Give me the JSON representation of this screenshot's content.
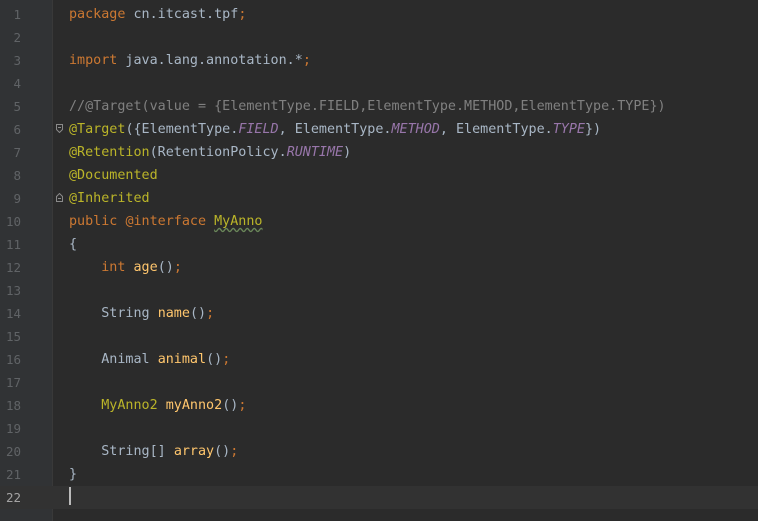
{
  "editor": {
    "current_line": 22,
    "lines": [
      {
        "number": "1",
        "t1": "package",
        "t2": " cn.itcast.tpf",
        "t3": ";"
      },
      {
        "number": "2"
      },
      {
        "number": "3",
        "t1": "import",
        "t2": " java.lang.annotation.*",
        "t3": ";"
      },
      {
        "number": "4"
      },
      {
        "number": "5",
        "t1": "//@Target(value = {ElementType.FIELD,ElementType.METHOD,ElementType.TYPE})"
      },
      {
        "number": "6",
        "t1": "@Target",
        "t2": "({ElementType.",
        "t3": "FIELD",
        "t4": ", ElementType.",
        "t5": "METHOD",
        "t6": ", ElementType.",
        "t7": "TYPE",
        "t8": "})"
      },
      {
        "number": "7",
        "t1": "@Retention",
        "t2": "(RetentionPolicy.",
        "t3": "RUNTIME",
        "t4": ")"
      },
      {
        "number": "8",
        "t1": "@Documented"
      },
      {
        "number": "9",
        "t1": "@Inherited"
      },
      {
        "number": "10",
        "t1": "public",
        "t2": " ",
        "t3": "@interface",
        "t4": " ",
        "t5": "MyAnno"
      },
      {
        "number": "11",
        "t1": "{"
      },
      {
        "number": "12",
        "t1": "    ",
        "t2": "int",
        "t3": " ",
        "t4": "age",
        "t5": "()",
        "t6": ";"
      },
      {
        "number": "13"
      },
      {
        "number": "14",
        "t1": "    String ",
        "t2": "name",
        "t3": "()",
        "t4": ";"
      },
      {
        "number": "15"
      },
      {
        "number": "16",
        "t1": "    Animal ",
        "t2": "animal",
        "t3": "()",
        "t4": ";"
      },
      {
        "number": "17"
      },
      {
        "number": "18",
        "t1": "    ",
        "t2": "MyAnno2",
        "t3": " ",
        "t4": "myAnno2",
        "t5": "()",
        "t6": ";"
      },
      {
        "number": "19"
      },
      {
        "number": "20",
        "t1": "    String[] ",
        "t2": "array",
        "t3": "()",
        "t4": ";"
      },
      {
        "number": "21",
        "t1": "}"
      },
      {
        "number": "22"
      }
    ]
  },
  "colors": {
    "background": "#2b2b2b",
    "gutter": "#313335",
    "keyword": "#cc7832",
    "annotation": "#bbb529",
    "comment": "#808080",
    "constant": "#9876aa",
    "method": "#ffc66d",
    "text": "#a9b7c6"
  },
  "icons": [
    "fold-open-icon",
    "fold-close-icon",
    "text-caret"
  ]
}
